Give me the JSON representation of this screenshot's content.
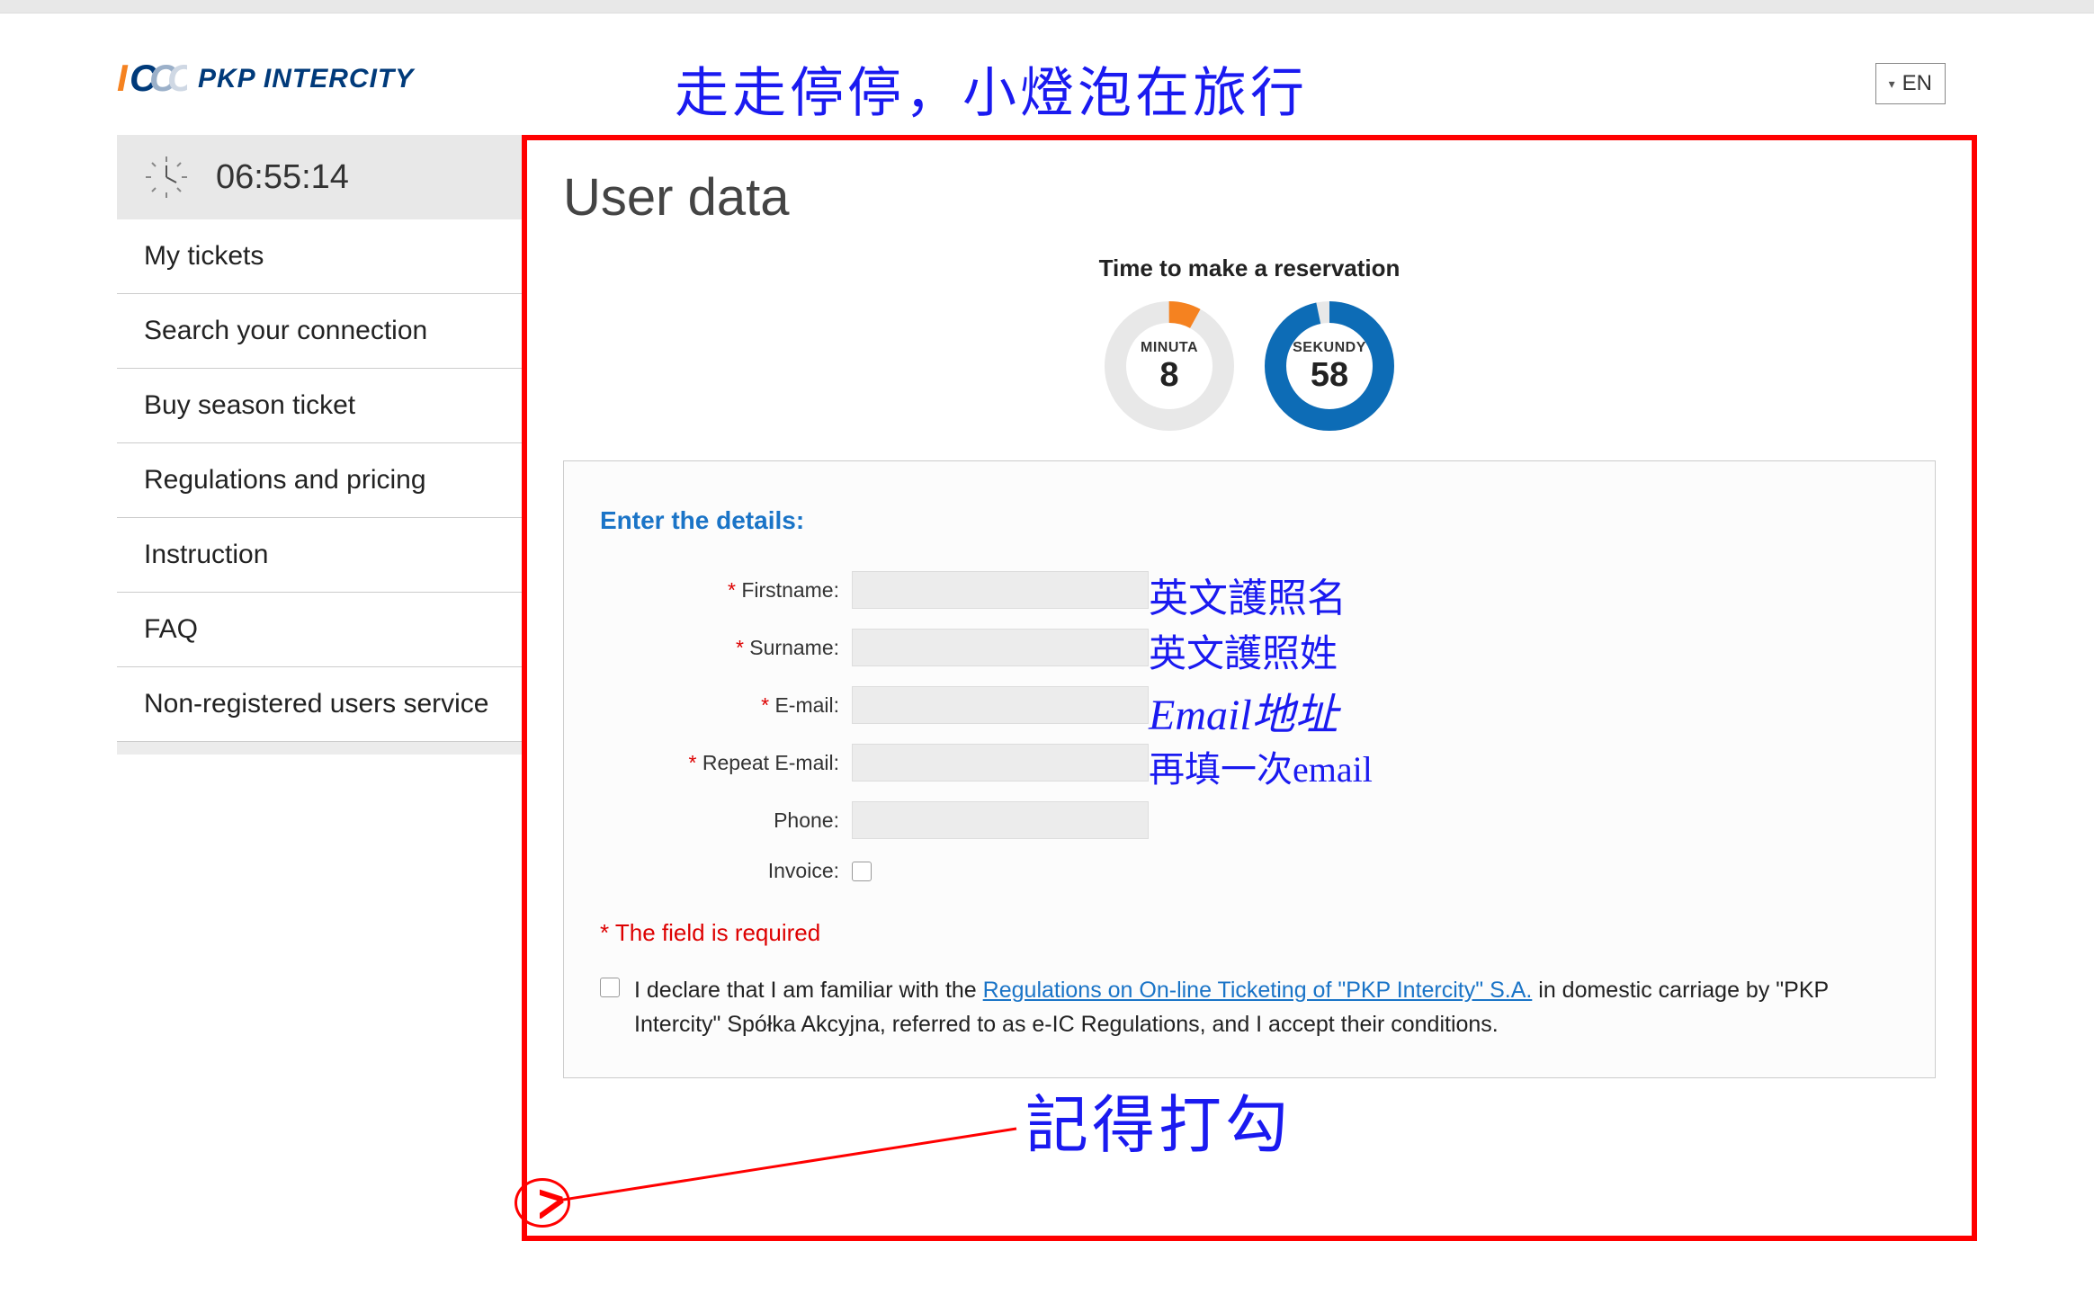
{
  "header": {
    "brand": "PKP INTERCITY",
    "handwriting_title": "走走停停，小燈泡在旅行",
    "lang": "EN"
  },
  "sidebar": {
    "clock": "06:55:14",
    "items": [
      "My tickets",
      "Search your connection",
      "Buy season ticket",
      "Regulations and pricing",
      "Instruction",
      "FAQ",
      "Non-registered users service"
    ]
  },
  "main": {
    "title": "User data",
    "timer_label": "Time to make a reservation",
    "minute_label": "MINUTA",
    "minute_value": "8",
    "second_label": "SEKUNDY",
    "second_value": "58",
    "form_heading": "Enter the details:",
    "labels": {
      "firstname": "Firstname:",
      "surname": "Surname:",
      "email": "E-mail:",
      "repeat_email": "Repeat E-mail:",
      "phone": "Phone:",
      "invoice": "Invoice:"
    },
    "required_note": "* The field is required",
    "declare_prefix": "I declare that I am familiar with the ",
    "declare_link": "Regulations on On-line Ticketing of \"PKP Intercity\" S.A.",
    "declare_suffix": " in domestic carriage by \"PKP Intercity\" Spółka Akcyjna, referred to as e-IC Regulations, and I accept their conditions."
  },
  "annotations": {
    "firstname": "英文護照名",
    "surname": "英文護照姓",
    "email": "Email地址",
    "repeat_email": "再填一次email",
    "check_reminder": "記得打勾"
  }
}
